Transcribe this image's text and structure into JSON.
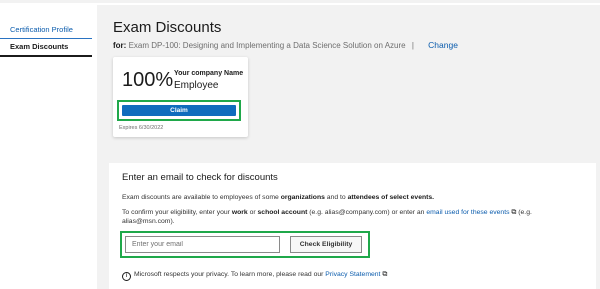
{
  "sidebar": {
    "items": [
      {
        "label": "Certification Profile"
      },
      {
        "label": "Exam Discounts"
      }
    ]
  },
  "header": {
    "title": "Exam Discounts",
    "for_label": "for:",
    "exam_name": "Exam DP-100: Designing and Implementing a Data Science Solution on Azure",
    "separator": "|",
    "change_label": "Change"
  },
  "card": {
    "percent": "100%",
    "company": "Your company Name",
    "group": "Employee",
    "claim_label": "Claim",
    "expires": "Expires 6/30/2022"
  },
  "check_panel": {
    "title": "Enter an email to check for discounts",
    "line1_a": "Exam discounts are available to employees of some ",
    "line1_b": "organizations",
    "line1_c": " and to ",
    "line1_d": "attendees of select events.",
    "line2_a": "To confirm your eligibility, enter your ",
    "line2_b": "work",
    "line2_c": " or ",
    "line2_d": "school account",
    "line2_e": " (e.g. alias@company.com) or enter an ",
    "line2_link": "email used for these events",
    "line2_f": " (e.g. alias@msn.com).",
    "email_placeholder": "Enter your email",
    "check_label": "Check Eligibility",
    "privacy_text": "Microsoft respects your privacy. To learn more, please read our ",
    "privacy_link": "Privacy Statement"
  },
  "colors": {
    "accent": "#0f6cbd",
    "link": "#0b5cad",
    "highlight": "#1fa84a"
  }
}
